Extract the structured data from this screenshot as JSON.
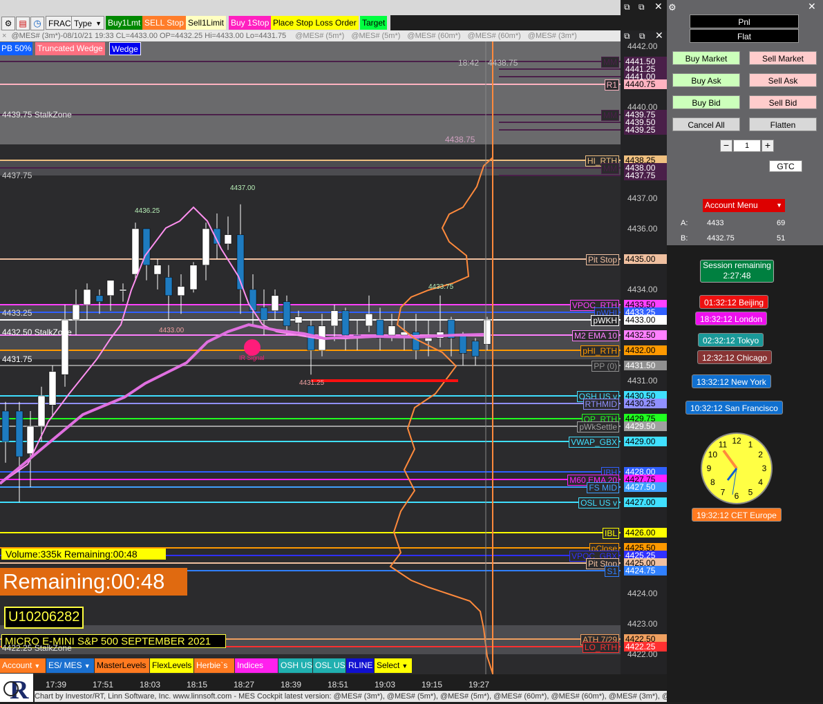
{
  "toolbar": {
    "frac": "FRAC",
    "type": "Type",
    "buy1lmt": "Buy1Lmt",
    "sellstop": "SELL Stop",
    "sell1limit": "Sell1Limit",
    "buy1stop": "Buy 1Stop",
    "placestop": "Place Stop Loss Order",
    "target": "Target"
  },
  "info_line": "@MES# (3m*)-08/10/21 19:33 CL=4433.00 OP=4432.25 Hi=4433.00 Lo=4431.75",
  "info_tabs": [
    "@MES# (5m*)",
    "@MES# (5m*)",
    "@MES# (60m*)",
    "@MES# (60m*)",
    "@MES# (3m*)"
  ],
  "tags": {
    "pb": "PB 50%",
    "truncated_wedge": "Truncated Wedge",
    "wedge": "Wedge"
  },
  "zones": {
    "z1": "4439.75 StalkZone",
    "z2": "4437.75",
    "z3": "4433.25",
    "z4": "4432.50 StalkZone",
    "z5": "4431.75",
    "z6": "4422.25 StalkZone"
  },
  "annotations": {
    "hi1": "4436.25",
    "hi2": "4437.00",
    "lo1": "4433.00",
    "hi3": "4433.75",
    "lo2": "4431.25",
    "ir": "IR Signal",
    "time_label": "18:42",
    "time_price": "4438.75",
    "price_ghost": "4438.75"
  },
  "overlays": {
    "volume": "Volume:335k Remaining:00:48",
    "remaining": "Remaining:00:48",
    "account": "U10206282",
    "instrument": "MICRO E-MINI S&P 500 SEPTEMBER 2021"
  },
  "levels": [
    {
      "label": "MM",
      "price": "4441.50",
      "color": "#4a1f49"
    },
    {
      "label": "",
      "price": "4441.25",
      "color": "#4a1f49"
    },
    {
      "label": "",
      "price": "4441.00",
      "color": "#4a1f49"
    },
    {
      "label": "R1",
      "price": "4440.75",
      "color": "#ffb3c1"
    },
    {
      "label": "MM",
      "price": "4439.75",
      "color": "#4a1f49"
    },
    {
      "label": "",
      "price": "4439.50",
      "color": "#4a1f49"
    },
    {
      "label": "",
      "price": "4439.25",
      "color": "#4a1f49"
    },
    {
      "label": "HI_RTH",
      "price": "4438.25",
      "color": "#f0c080"
    },
    {
      "label": "MM",
      "price": "4438.00",
      "color": "#4a1f49"
    },
    {
      "label": "",
      "price": "4437.75",
      "color": "#4a1f49"
    },
    {
      "label": "Pit Stop",
      "price": "4435.00",
      "color": "#f0c0a0"
    },
    {
      "label": "VPOC_RTH",
      "price": "4433.50",
      "color": "#ff40ff"
    },
    {
      "label": "pWHI",
      "price": "4433.25",
      "color": "#3060ff"
    },
    {
      "label": "pWKH",
      "price": "4433.00",
      "color": "#ffffff"
    },
    {
      "label": "M2 EMA 10",
      "price": "4432.50",
      "color": "#ff80ff"
    },
    {
      "label": "pHI_RTH",
      "price": "4432.00",
      "color": "#ff9900"
    },
    {
      "label": "PP (0)",
      "price": "4431.50",
      "color": "#909090"
    },
    {
      "label": "OSH US v",
      "price": "4430.50",
      "color": "#40e0ff"
    },
    {
      "label": "RTHMID",
      "price": "4430.25",
      "color": "#9090ff"
    },
    {
      "label": "OP_RTH",
      "price": "4429.75",
      "color": "#20ff20"
    },
    {
      "label": "pWkSettle",
      "price": "4429.50",
      "color": "#a0a0a0"
    },
    {
      "label": "VWAP_GBX",
      "price": "4429.00",
      "color": "#40e0ff"
    },
    {
      "label": "IBH",
      "price": "4428.00",
      "color": "#3060ff"
    },
    {
      "label": "M60 EMA 20",
      "price": "4427.75",
      "color": "#ff20ff"
    },
    {
      "label": "FS MID",
      "price": "4427.50",
      "color": "#40a0ff"
    },
    {
      "label": "OSL US v",
      "price": "4427.00",
      "color": "#40e0ff"
    },
    {
      "label": "IBL",
      "price": "4426.00",
      "color": "#ffff00"
    },
    {
      "label": "pClose",
      "price": "4425.50",
      "color": "#ff9900"
    },
    {
      "label": "VPOC_GBX",
      "price": "4425.25",
      "color": "#3030ff"
    },
    {
      "label": "Pit Stop",
      "price": "4425.00",
      "color": "#f0c0a0"
    },
    {
      "label": "S1",
      "price": "4424.75",
      "color": "#3080ff"
    },
    {
      "label": "ATH 7/29",
      "price": "4422.50",
      "color": "#f0a060"
    },
    {
      "label": "LO_RTH",
      "price": "4422.25",
      "color": "#ff3030"
    }
  ],
  "axis_ticks": [
    "4442.00",
    "4440.00",
    "4437.00",
    "4436.00",
    "4434.00",
    "4433.00",
    "4431.00",
    "4424.00",
    "4423.00",
    "4422.00"
  ],
  "time_labels": [
    "17:39",
    "17:51",
    "18:03",
    "18:15",
    "18:27",
    "18:39",
    "18:51",
    "19:03",
    "19:15",
    "19:27"
  ],
  "bottom_tabs": [
    "Account",
    "ES/ MES",
    "MasterLevels",
    "FlexLevels",
    "Herbie`s",
    "Indices",
    "OSH US",
    "OSL US",
    "RLINE",
    "Select"
  ],
  "footer": "Chart by Investor/RT, Linn Software, Inc. www.linnsoft.com - MES Cockpit latest version: @MES# (3m*), @MES# (5m*), @MES# (5m*), @MES# (60m*), @MES# (60m*), @MES# (3m*), @",
  "panel": {
    "pnl": "Pnl",
    "flat": "Flat",
    "buy_market": "Buy Market",
    "sell_market": "Sell Market",
    "buy_ask": "Buy Ask",
    "sell_ask": "Sell Ask",
    "buy_bid": "Buy Bid",
    "sell_bid": "Sell Bid",
    "cancel_all": "Cancel All",
    "flatten": "Flatten",
    "qty": "1",
    "gtc": "GTC",
    "account_menu": "Account Menu",
    "a_label": "A:",
    "a_price": "4433",
    "a_size": "69",
    "b_label": "B:",
    "b_price": "4432.75",
    "b_size": "51"
  },
  "clocks": {
    "session_title": "Session remaining",
    "session_time": "2:27:48",
    "beijing": "01:32:12 Beijing",
    "london": "18:32:12 London",
    "tokyo": "02:32:12 Tokyo",
    "chicago": "12:32:12 Chicago",
    "newyork": "13:32:12 New York",
    "sf": "10:32:12 San Francisco",
    "cet": "19:32:12 CET Europe",
    "dial": [
      "12",
      "1",
      "2",
      "3",
      "4",
      "5",
      "6",
      "7",
      "8",
      "9",
      "10",
      "11"
    ]
  },
  "colors": {
    "up_candle": "#ffffff",
    "down_candle": "#1e7bc0",
    "sma_pink": "#ff90f0",
    "ema_orange": "#ff8a3c"
  }
}
